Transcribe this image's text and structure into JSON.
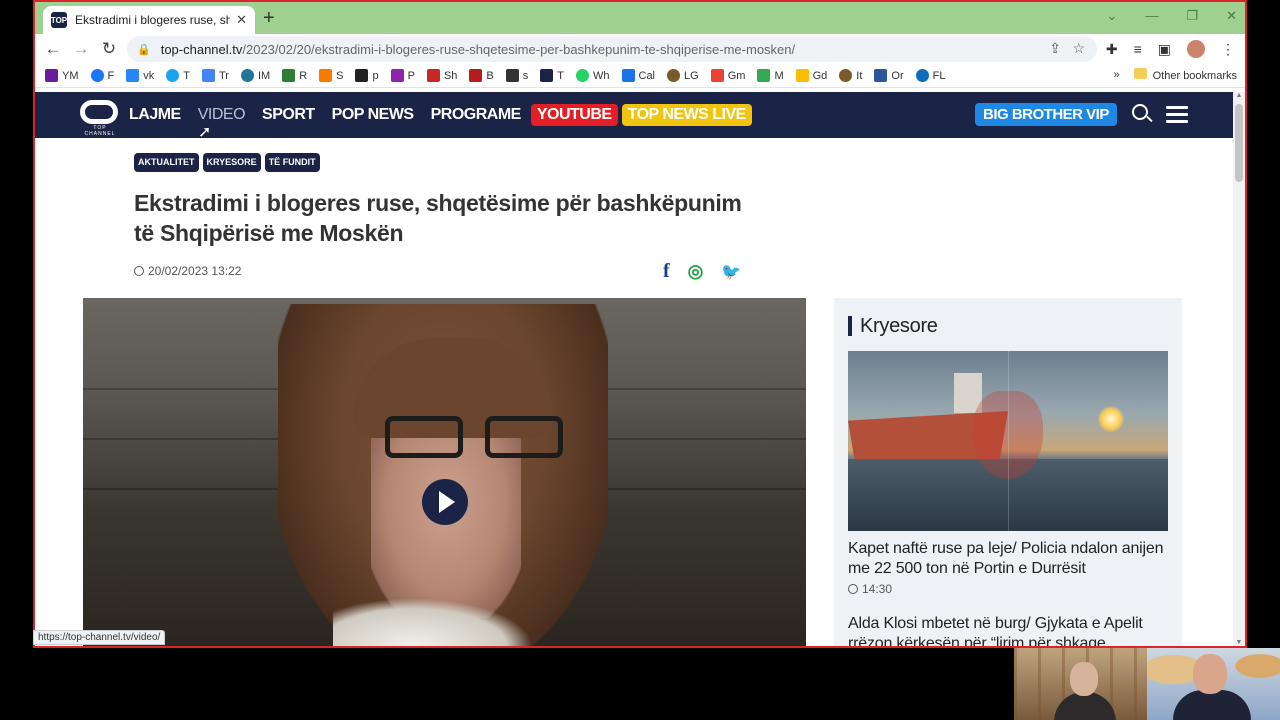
{
  "browser": {
    "tab_title": "Ekstradimi i blogeres ruse, shqetë",
    "favicon_text": "TOP",
    "url_host": "top-channel.tv",
    "url_path": "/2023/02/20/ekstradimi-i-blogeres-ruse-shqetesime-per-bashkepunim-te-shqiperise-me-mosken/",
    "bookmarks": [
      {
        "label": "YM",
        "color": "#6a1b9a"
      },
      {
        "label": "F",
        "color": "#1877f2"
      },
      {
        "label": "vk",
        "color": "#2787f5"
      },
      {
        "label": "T",
        "color": "#1da1f2"
      },
      {
        "label": "Tr",
        "color": "#4285f4"
      },
      {
        "label": "IM",
        "color": "#21759b"
      },
      {
        "label": "R",
        "color": "#2e7d32"
      },
      {
        "label": "S",
        "color": "#f57c00"
      },
      {
        "label": "p",
        "color": "#222222"
      },
      {
        "label": "P",
        "color": "#8e24aa"
      },
      {
        "label": "Sh",
        "color": "#c62828"
      },
      {
        "label": "B",
        "color": "#b71c1c"
      },
      {
        "label": "s",
        "color": "#333333"
      },
      {
        "label": "T",
        "color": "#1b2346"
      },
      {
        "label": "Wh",
        "color": "#25d366"
      },
      {
        "label": "Cal",
        "color": "#1a73e8"
      },
      {
        "label": "LG",
        "color": "#7a5a2a"
      },
      {
        "label": "Gm",
        "color": "#ea4335"
      },
      {
        "label": "M",
        "color": "#34a853"
      },
      {
        "label": "Gd",
        "color": "#fbbc04"
      },
      {
        "label": "It",
        "color": "#7a5a2a"
      },
      {
        "label": "Or",
        "color": "#2b579a"
      },
      {
        "label": "FL",
        "color": "#0f6cbd"
      }
    ],
    "bookmarks_more": "»",
    "other_bookmarks": "Other bookmarks",
    "status_url": "https://top-channel.tv/video/"
  },
  "site": {
    "logo_caption": "TOP CHANNEL",
    "nav": {
      "lajme": "LAJME",
      "video": "VIDEO",
      "sport": "SPORT",
      "pop_news": "POP NEWS",
      "programe": "PROGRAME",
      "youtube": "YOUTUBE",
      "top_news_live": "TOP NEWS LIVE"
    },
    "big_brother": "BIG BROTHER VIP",
    "colors": {
      "navy": "#1b2346",
      "youtube": "#e31e24",
      "live": "#f1c40f",
      "bb": "#1e88e5"
    }
  },
  "article": {
    "tags": [
      "AKTUALITET",
      "KRYESORE",
      "TË FUNDIT"
    ],
    "headline": "Ekstradimi i blogeres ruse, shqetësime për bashkëpunim të Shqipërisë me Moskën",
    "date": "20/02/2023 13:22",
    "share": {
      "facebook": "f",
      "whatsapp": "◎",
      "twitter": "🐦"
    }
  },
  "sidebar": {
    "heading": "Kryesore",
    "items": [
      {
        "title": "Kapet naftë ruse pa leje/ Policia ndalon anijen me 22 500 ton në Portin e Durrësit",
        "time": "14:30"
      },
      {
        "title": "Alda Klosi mbetet në burg/ Gjykata e Apelit rrëzon kërkesën për “lirim për shkage"
      }
    ]
  }
}
